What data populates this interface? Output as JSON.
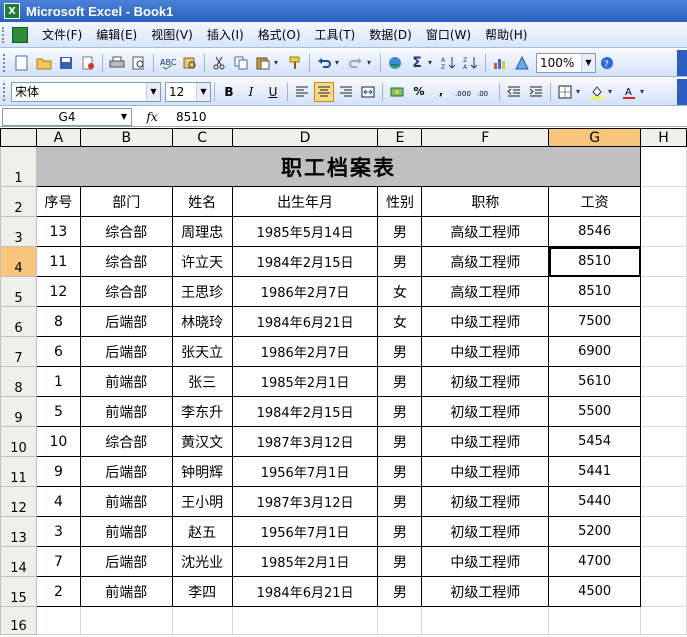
{
  "window": {
    "title": "Microsoft Excel - Book1"
  },
  "menu": [
    "文件(F)",
    "编辑(E)",
    "视图(V)",
    "插入(I)",
    "格式(O)",
    "工具(T)",
    "数据(D)",
    "窗口(W)",
    "帮助(H)"
  ],
  "toolbar": {
    "zoom": "100%",
    "font_name": "宋体",
    "font_size": "12",
    "bold": "B",
    "italic": "I",
    "underline": "U",
    "percent": "%",
    "comma": ",",
    "sum": "Σ"
  },
  "formula_bar": {
    "cell_ref": "G4",
    "fx": "fx",
    "value": "8510"
  },
  "columns": [
    "A",
    "B",
    "C",
    "D",
    "E",
    "F",
    "G",
    "H"
  ],
  "selected_column": "G",
  "selected_row": "4",
  "sheet_title": "职工档案表",
  "headers": [
    "序号",
    "部门",
    "姓名",
    "出生年月",
    "性别",
    "职称",
    "工资"
  ],
  "rows": [
    [
      "13",
      "综合部",
      "周理忠",
      "1985年5月14日",
      "男",
      "高级工程师",
      "8546"
    ],
    [
      "11",
      "综合部",
      "许立天",
      "1984年2月15日",
      "男",
      "高级工程师",
      "8510"
    ],
    [
      "12",
      "综合部",
      "王思珍",
      "1986年2月7日",
      "女",
      "高级工程师",
      "8510"
    ],
    [
      "8",
      "后端部",
      "林晓玲",
      "1984年6月21日",
      "女",
      "中级工程师",
      "7500"
    ],
    [
      "6",
      "后端部",
      "张天立",
      "1986年2月7日",
      "男",
      "中级工程师",
      "6900"
    ],
    [
      "1",
      "前端部",
      "张三",
      "1985年2月1日",
      "男",
      "初级工程师",
      "5610"
    ],
    [
      "5",
      "前端部",
      "李东升",
      "1984年2月15日",
      "男",
      "初级工程师",
      "5500"
    ],
    [
      "10",
      "综合部",
      "黄汉文",
      "1987年3月12日",
      "男",
      "中级工程师",
      "5454"
    ],
    [
      "9",
      "后端部",
      "钟明辉",
      "1956年7月1日",
      "男",
      "中级工程师",
      "5441"
    ],
    [
      "4",
      "前端部",
      "王小明",
      "1987年3月12日",
      "男",
      "初级工程师",
      "5440"
    ],
    [
      "3",
      "前端部",
      "赵五",
      "1956年7月1日",
      "男",
      "初级工程师",
      "5200"
    ],
    [
      "7",
      "后端部",
      "沈光业",
      "1985年2月1日",
      "男",
      "中级工程师",
      "4700"
    ],
    [
      "2",
      "前端部",
      "李四",
      "1984年6月21日",
      "男",
      "初级工程师",
      "4500"
    ]
  ],
  "row_numbers": [
    "1",
    "2",
    "3",
    "4",
    "5",
    "6",
    "7",
    "8",
    "9",
    "10",
    "11",
    "12",
    "13",
    "14",
    "15",
    "16"
  ]
}
